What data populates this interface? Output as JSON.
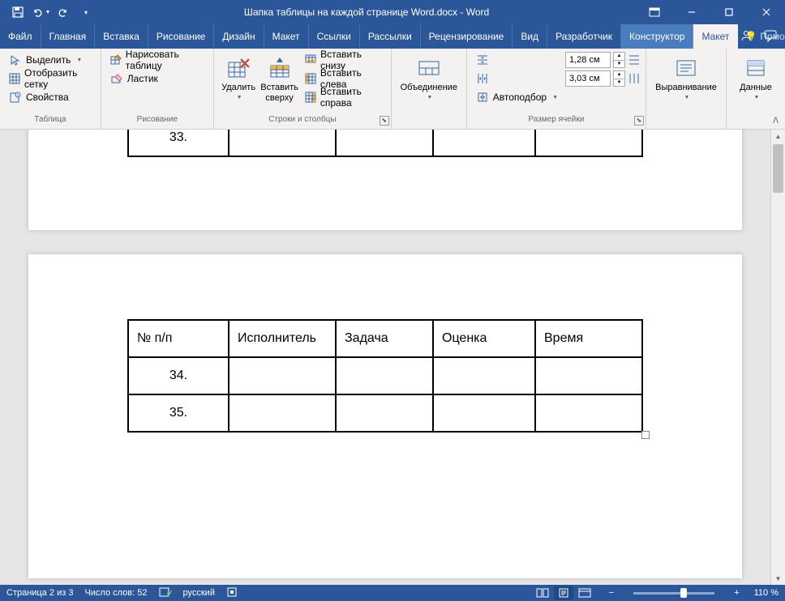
{
  "title": "Шапка таблицы на каждой странице Word.docx  -  Word",
  "tabs": {
    "file": "Файл",
    "items": [
      "Главная",
      "Вставка",
      "Рисование",
      "Дизайн",
      "Макет",
      "Ссылки",
      "Рассылки",
      "Рецензирование",
      "Вид",
      "Разработчик",
      "Конструктор",
      "Макет"
    ],
    "active_index": 11,
    "tellme": "Помощн"
  },
  "ribbon": {
    "g_table": {
      "label": "Таблица",
      "select": "Выделить",
      "gridlines": "Отобразить сетку",
      "properties": "Свойства"
    },
    "g_draw": {
      "label": "Рисование",
      "draw": "Нарисовать таблицу",
      "eraser": "Ластик"
    },
    "g_rowscols": {
      "label": "Строки и столбцы",
      "delete": "Удалить",
      "insert_above": "Вставить\nсверху",
      "insert_below": "Вставить снизу",
      "insert_left": "Вставить слева",
      "insert_right": "Вставить справа"
    },
    "g_merge": {
      "label": "",
      "merge": "Объединение"
    },
    "g_cellsize": {
      "label": "Размер ячейки",
      "height": "1,28 см",
      "width": "3,03 см",
      "autofit": "Автоподбор"
    },
    "g_align": {
      "label": "",
      "align": "Выравнивание"
    },
    "g_data": {
      "label": "",
      "data": "Данные"
    }
  },
  "document": {
    "page1_rows": [
      "33."
    ],
    "headers": [
      "№ п/п",
      "Исполнитель",
      "Задача",
      "Оценка",
      "Время"
    ],
    "page2_rows": [
      "34.",
      "35."
    ]
  },
  "status": {
    "page": "Страница 2 из 3",
    "words": "Число слов: 52",
    "lang": "русский",
    "zoom": "110 %"
  }
}
